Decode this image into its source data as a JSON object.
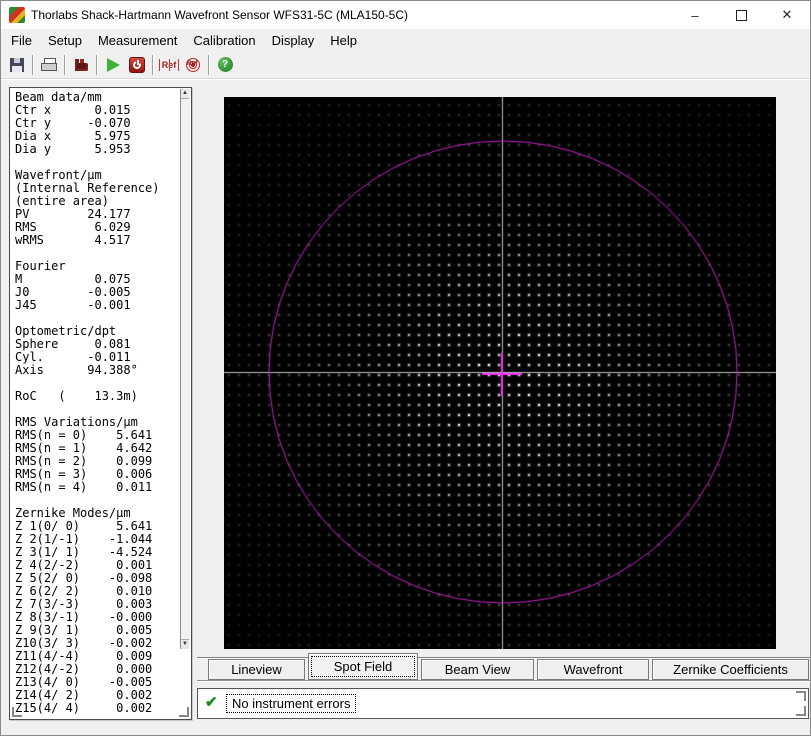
{
  "window": {
    "title": "Thorlabs Shack-Hartmann Wavefront Sensor WFS31-5C (MLA150-5C)",
    "controls": {
      "minimize": "–",
      "close": "✕"
    }
  },
  "menu": {
    "items": [
      "File",
      "Setup",
      "Measurement",
      "Calibration",
      "Display",
      "Help"
    ]
  },
  "toolbar": {
    "icons": [
      "save",
      "print",
      "instrument-settings",
      "start-measurement",
      "stop-measurement",
      "reference-plane",
      "reference-sphere",
      "help"
    ],
    "ref_label": "Ref",
    "help_glyph": "?"
  },
  "data_panel": {
    "lines": [
      "Beam data/mm",
      "Ctr x      0.015",
      "Ctr y     -0.070",
      "Dia x      5.975",
      "Dia y      5.953",
      "",
      "Wavefront/µm",
      "(Internal Reference)",
      "(entire area)",
      "PV        24.177",
      "RMS        6.029",
      "wRMS       4.517",
      "",
      "Fourier",
      "M          0.075",
      "J0        -0.005",
      "J45       -0.001",
      "",
      "Optometric/dpt",
      "Sphere     0.081",
      "Cyl.      -0.011",
      "Axis      94.388°",
      "",
      "RoC   (    13.3m)",
      "",
      "RMS Variations/µm",
      "RMS(n = 0)    5.641",
      "RMS(n = 1)    4.642",
      "RMS(n = 2)    0.099",
      "RMS(n = 3)    0.006",
      "RMS(n = 4)    0.011",
      "",
      "Zernike Modes/µm",
      "Z 1(0/ 0)     5.641",
      "Z 2(1/-1)    -1.044",
      "Z 3(1/ 1)    -4.524",
      "Z 4(2/-2)     0.001",
      "Z 5(2/ 0)    -0.098",
      "Z 6(2/ 2)     0.010",
      "Z 7(3/-3)     0.003",
      "Z 8(3/-1)    -0.000",
      "Z 9(3/ 1)     0.005",
      "Z10(3/ 3)    -0.002",
      "Z11(4/-4)     0.009",
      "Z12(4/-2)     0.000",
      "Z13(4/ 0)    -0.005",
      "Z14(4/ 2)     0.002",
      "Z15(4/ 4)     0.002"
    ]
  },
  "spot_field": {
    "background": "#000000",
    "dot_color": "#ffffff",
    "grid_spacing_px": 10,
    "crosshair_color": "#bdbdbd",
    "pupil_circle_color": "#c722c7",
    "centroid_marker_color": "#ff2dff"
  },
  "tabs": {
    "items": [
      {
        "label": "Lineview"
      },
      {
        "label": "Spot Field"
      },
      {
        "label": "Beam View"
      },
      {
        "label": "Wavefront"
      },
      {
        "label": "Zernike Coefficients"
      }
    ],
    "selected": "Spot Field"
  },
  "status": {
    "message": "No instrument errors",
    "check_glyph": "✔",
    "ok_color": "#1e8c1e"
  }
}
